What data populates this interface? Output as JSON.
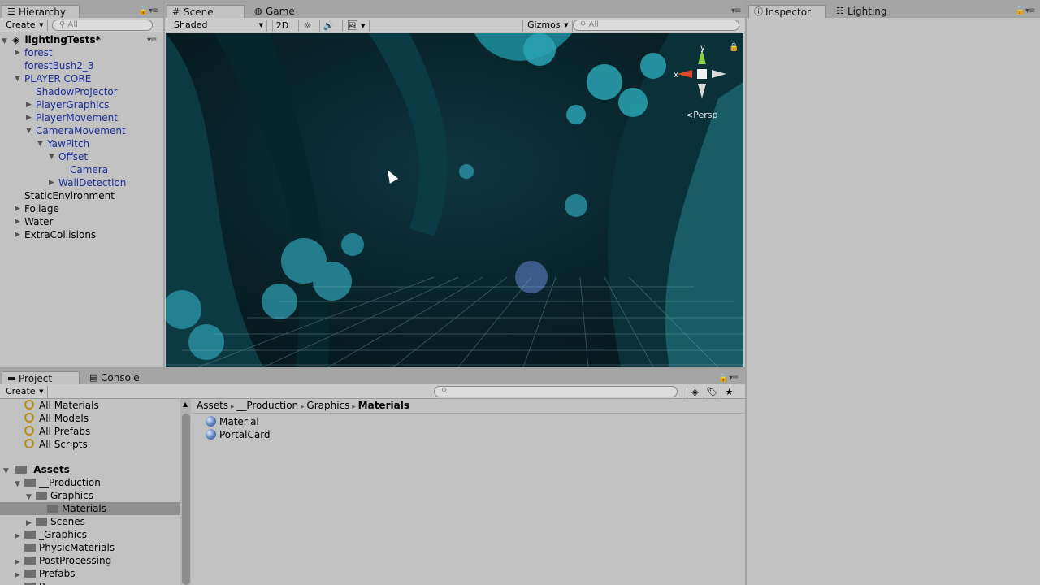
{
  "hierarchy": {
    "tab_label": "Hierarchy",
    "create_label": "Create",
    "search_placeholder": "All",
    "scene_name": "lightingTests*",
    "items": [
      {
        "label": "forest",
        "exp": "▶",
        "blue": true
      },
      {
        "label": "forestBush2_3",
        "exp": "",
        "blue": true
      },
      {
        "label": "PLAYER CORE",
        "exp": "▼",
        "blue": true
      },
      {
        "label": "ShadowProjector",
        "exp": "",
        "blue": true
      },
      {
        "label": "PlayerGraphics",
        "exp": "▶",
        "blue": true
      },
      {
        "label": "PlayerMovement",
        "exp": "▶",
        "blue": true
      },
      {
        "label": "CameraMovement",
        "exp": "▼",
        "blue": true
      },
      {
        "label": "YawPitch",
        "exp": "▼",
        "blue": true
      },
      {
        "label": "Offset",
        "exp": "▼",
        "blue": true
      },
      {
        "label": "Camera",
        "exp": "",
        "blue": true
      },
      {
        "label": "WallDetection",
        "exp": "▶",
        "blue": true
      },
      {
        "label": "StaticEnvironment",
        "exp": "",
        "blue": false
      },
      {
        "label": "Foliage",
        "exp": "▶",
        "blue": false
      },
      {
        "label": "Water",
        "exp": "▶",
        "blue": false
      },
      {
        "label": "ExtraCollisions",
        "exp": "▶",
        "blue": false
      }
    ]
  },
  "scene": {
    "tabs": [
      "Scene",
      "Game"
    ],
    "shading_mode": "Shaded",
    "toggle_2d": "2D",
    "gizmos_label": "Gizmos",
    "search_placeholder": "All",
    "persp_label": "Persp",
    "axis_y": "y",
    "axis_x": "x"
  },
  "inspector": {
    "tabs": [
      "Inspector",
      "Lighting"
    ]
  },
  "project": {
    "tabs": [
      "Project",
      "Console"
    ],
    "create_label": "Create",
    "favorites": [
      "All Materials",
      "All Models",
      "All Prefabs",
      "All Scripts"
    ],
    "assets_root": "Assets",
    "tree": [
      {
        "label": "__Production",
        "exp": "▼"
      },
      {
        "label": "Graphics",
        "exp": "▼"
      },
      {
        "label": "Materials",
        "exp": "",
        "selected": true
      },
      {
        "label": "Scenes",
        "exp": "▶"
      },
      {
        "label": "_Graphics",
        "exp": "▶"
      },
      {
        "label": "PhysicMaterials",
        "exp": ""
      },
      {
        "label": "PostProcessing",
        "exp": "▶"
      },
      {
        "label": "Prefabs",
        "exp": "▶"
      },
      {
        "label": "R...",
        "exp": ""
      }
    ],
    "breadcrumb": [
      "Assets",
      "__Production",
      "Graphics",
      "Materials"
    ],
    "files": [
      "Material",
      "PortalCard"
    ]
  }
}
